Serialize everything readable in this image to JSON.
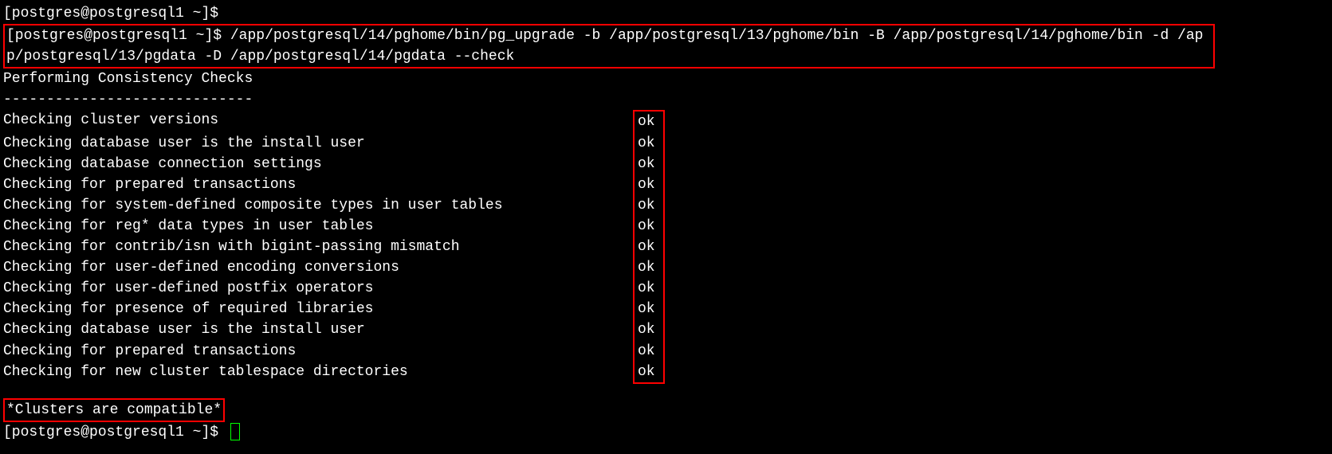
{
  "prompt": "[postgres@postgresql1 ~]$",
  "command": "/app/postgresql/14/pghome/bin/pg_upgrade -b /app/postgresql/13/pghome/bin -B /app/postgresql/14/pghome/bin -d /app/postgresql/13/pgdata -D /app/postgresql/14/pgdata --check",
  "header": "Performing Consistency Checks",
  "divider": "-----------------------------",
  "checks": [
    {
      "label": "Checking cluster versions",
      "status": "ok"
    },
    {
      "label": "Checking database user is the install user",
      "status": "ok"
    },
    {
      "label": "Checking database connection settings",
      "status": "ok"
    },
    {
      "label": "Checking for prepared transactions",
      "status": "ok"
    },
    {
      "label": "Checking for system-defined composite types in user tables",
      "status": "ok"
    },
    {
      "label": "Checking for reg* data types in user tables",
      "status": "ok"
    },
    {
      "label": "Checking for contrib/isn with bigint-passing mismatch",
      "status": "ok"
    },
    {
      "label": "Checking for user-defined encoding conversions",
      "status": "ok"
    },
    {
      "label": "Checking for user-defined postfix operators",
      "status": "ok"
    },
    {
      "label": "Checking for presence of required libraries",
      "status": "ok"
    },
    {
      "label": "Checking database user is the install user",
      "status": "ok"
    },
    {
      "label": "Checking for prepared transactions",
      "status": "ok"
    },
    {
      "label": "Checking for new cluster tablespace directories",
      "status": "ok"
    }
  ],
  "compat": "*Clusters are compatible*"
}
